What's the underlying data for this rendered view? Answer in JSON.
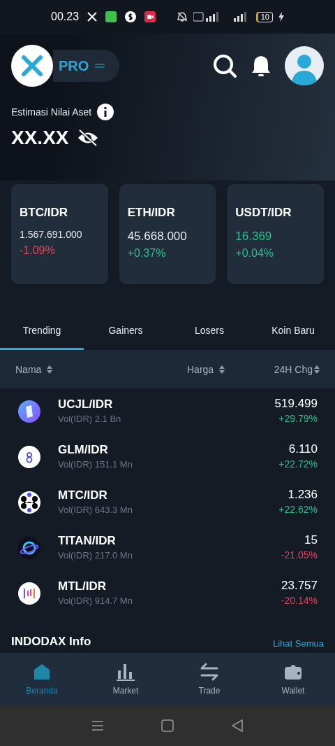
{
  "status_bar": {
    "time": "00.23",
    "battery": "10"
  },
  "header": {
    "badge": "PRO"
  },
  "asset": {
    "label": "Estimasi Nilai Aset",
    "value": "XX.XX"
  },
  "cards": [
    {
      "pair": "BTC/IDR",
      "price": "1.567.691.000",
      "price_colored": false,
      "change": "-1.09%",
      "negative": true
    },
    {
      "pair": "ETH/IDR",
      "price": "45.668.000",
      "price_colored": false,
      "change": "+0.37%",
      "negative": false
    },
    {
      "pair": "USDT/IDR",
      "price": "16.369",
      "price_colored": true,
      "change": "+0.04%",
      "negative": false
    }
  ],
  "tabs": [
    {
      "label": "Trending",
      "selected": true
    },
    {
      "label": "Gainers",
      "selected": false
    },
    {
      "label": "Losers",
      "selected": false
    },
    {
      "label": "Koin Baru",
      "selected": false
    }
  ],
  "table": {
    "columns": [
      "Nama",
      "Harga",
      "24H Chg"
    ],
    "rows": [
      {
        "kind": "ucjl",
        "pair": "UCJL/IDR",
        "volume": "Vol(IDR) 2.1 Bn",
        "price": "519.499",
        "change": "+29.79%",
        "negative": false
      },
      {
        "kind": "glm",
        "pair": "GLM/IDR",
        "volume": "Vol(IDR) 151.1 Mn",
        "price": "6.110",
        "change": "+22.72%",
        "negative": false
      },
      {
        "kind": "mtc",
        "pair": "MTC/IDR",
        "volume": "Vol(IDR) 643.3 Mn",
        "price": "1.236",
        "change": "+22.62%",
        "negative": false
      },
      {
        "kind": "titan",
        "pair": "TITAN/IDR",
        "volume": "Vol(IDR) 217.0 Mn",
        "price": "15",
        "change": "-21.05%",
        "negative": true
      },
      {
        "kind": "mtl",
        "pair": "MTL/IDR",
        "volume": "Vol(IDR) 914.7 Mn",
        "price": "23.757",
        "change": "-20.14%",
        "negative": true
      }
    ]
  },
  "info_section": {
    "title": "INDODAX Info",
    "link": "Lihat Semua"
  },
  "bottom_nav": [
    {
      "kind": "home",
      "label": "Beranda",
      "selected": true
    },
    {
      "kind": "market",
      "label": "Market",
      "selected": false
    },
    {
      "kind": "trade",
      "label": "Trade",
      "selected": false
    },
    {
      "kind": "wallet",
      "label": "Wallet",
      "selected": false
    }
  ]
}
